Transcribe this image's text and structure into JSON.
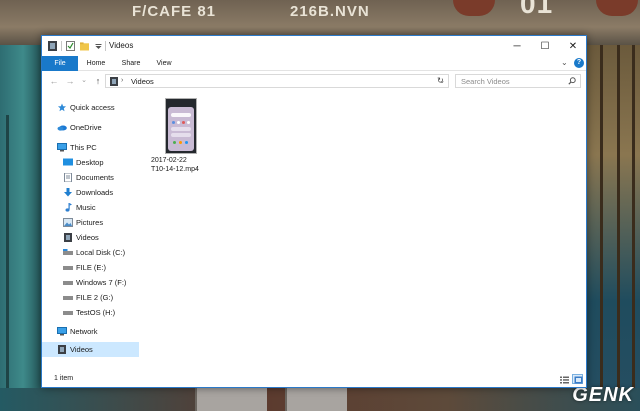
{
  "background": {
    "sign_texts": [
      "F/CAFE 81",
      "216B.NVN",
      "01"
    ],
    "watermark": "GENK"
  },
  "window": {
    "title": "Videos",
    "controls": {
      "minimize": "─",
      "maximize": "☐",
      "close": "✕"
    }
  },
  "ribbon": {
    "tabs": [
      "File",
      "Home",
      "Share",
      "View"
    ],
    "expand_icon": "⌄",
    "help_icon": "?"
  },
  "address_bar": {
    "back": "←",
    "forward": "→",
    "recent": "⌄",
    "up": "↑",
    "path": "Videos",
    "separator": "›",
    "dropdown": "⌄",
    "refresh": "↻"
  },
  "search": {
    "placeholder": "Search Videos"
  },
  "nav_pane": {
    "items": [
      {
        "label": "Quick access",
        "icon": "star-icon"
      },
      {
        "label": "OneDrive",
        "icon": "onedrive-icon"
      },
      {
        "label": "This PC",
        "icon": "computer-icon"
      },
      {
        "label": "Desktop",
        "icon": "desktop-icon"
      },
      {
        "label": "Documents",
        "icon": "documents-icon"
      },
      {
        "label": "Downloads",
        "icon": "downloads-icon"
      },
      {
        "label": "Music",
        "icon": "music-icon"
      },
      {
        "label": "Pictures",
        "icon": "pictures-icon"
      },
      {
        "label": "Videos",
        "icon": "videos-icon"
      },
      {
        "label": "Local Disk (C:)",
        "icon": "drive-icon"
      },
      {
        "label": "FILE (E:)",
        "icon": "drive-icon"
      },
      {
        "label": "Windows 7 (F:)",
        "icon": "drive-icon"
      },
      {
        "label": "FILE 2 (G:)",
        "icon": "drive-icon"
      },
      {
        "label": "TestOS (H:)",
        "icon": "drive-icon"
      },
      {
        "label": "Network",
        "icon": "network-icon"
      },
      {
        "label": "Videos",
        "icon": "videos-icon",
        "selected": true
      }
    ]
  },
  "files": [
    {
      "name_line1": "2017-02-22",
      "name_line2": "T10-14-12.mp4",
      "icon": "video-thumbnail-icon"
    }
  ],
  "status": {
    "item_count": "1 item",
    "view_details": "details-view-icon",
    "view_large_icons": "large-icons-view-icon"
  },
  "colors": {
    "accent": "#1979ca",
    "selection": "#cce8ff",
    "window_border": "#2b79c9"
  }
}
